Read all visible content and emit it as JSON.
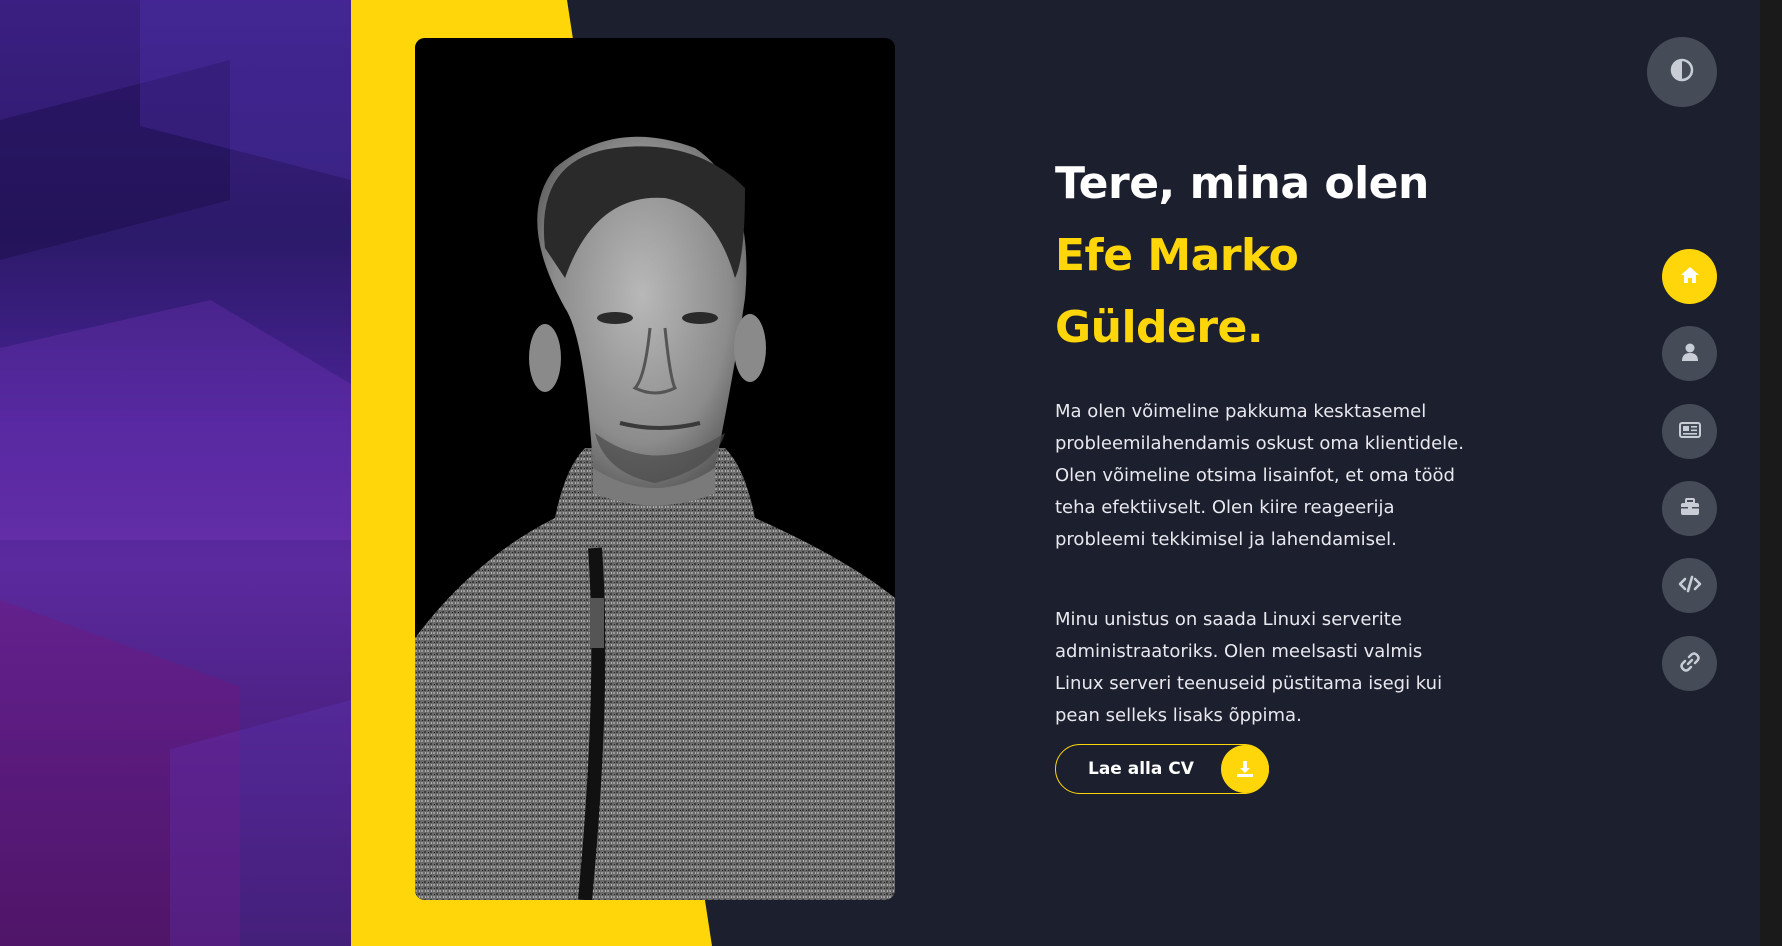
{
  "hero": {
    "greeting": "Tere, mina olen",
    "name_line1": "Efe Marko",
    "name_line2": "Güldere.",
    "paragraph1": "Ma olen võimeline pakkuma kesktasemel probleemilahendamis oskust oma klientidele. Olen võimeline otsima lisainfot, et oma tööd teha efektiivselt. Olen kiire reageerija probleemi tekkimisel ja lahendamisel.",
    "paragraph2": "Minu unistus on saada Linuxi serverite administraatoriks. Olen meelsasti valmis Linux serveri teenuseid püstitama isegi kui pean selleks lisaks õppima.",
    "cv_button_label": "Lae alla CV"
  },
  "nav": {
    "items": [
      {
        "icon": "home-icon",
        "active": true
      },
      {
        "icon": "user-icon",
        "active": false
      },
      {
        "icon": "newspaper-icon",
        "active": false
      },
      {
        "icon": "briefcase-icon",
        "active": false
      },
      {
        "icon": "code-icon",
        "active": false
      },
      {
        "icon": "link-icon",
        "active": false
      }
    ]
  },
  "theme_toggle": {
    "icon": "contrast-icon"
  },
  "colors": {
    "accent": "#ffd60a",
    "panel": "#1c1f2e",
    "nav_button": "#454b57",
    "text": "#ffffff"
  }
}
